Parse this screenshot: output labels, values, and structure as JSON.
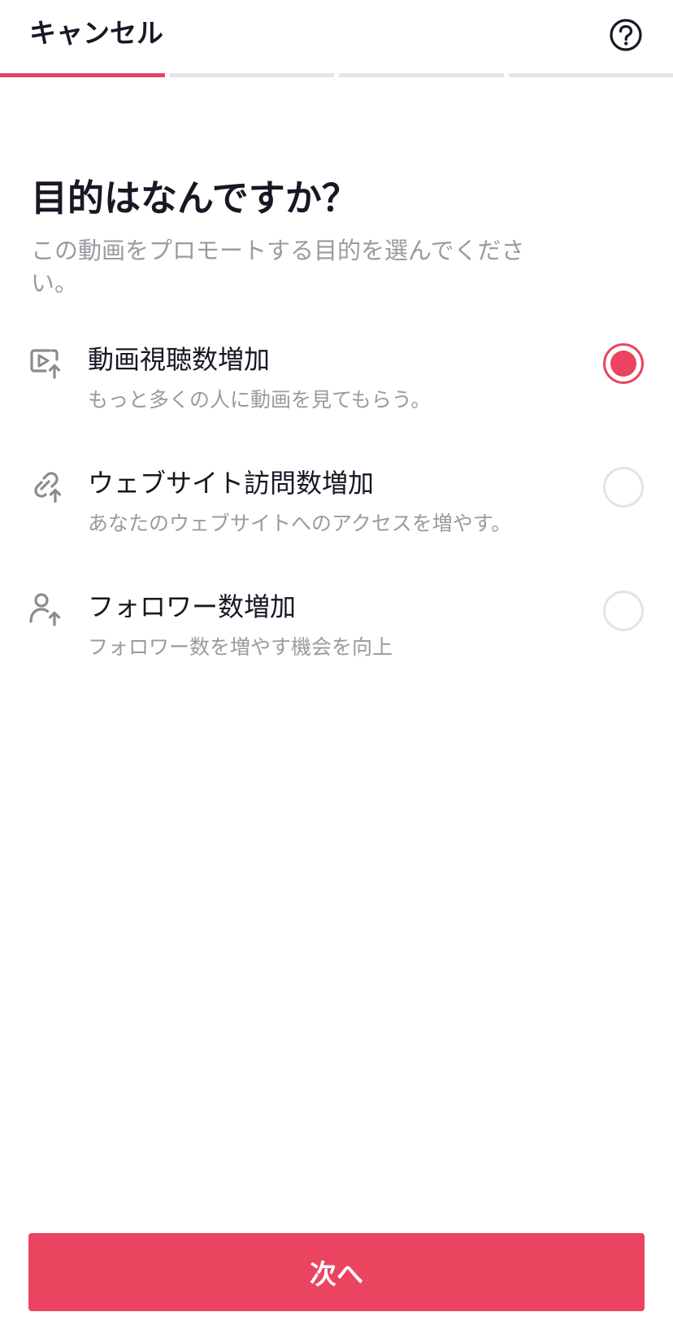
{
  "header": {
    "cancel_label": "キャンセル",
    "help_icon": "question-circle-icon"
  },
  "progress": {
    "total_steps": 4,
    "current_step": 1
  },
  "main": {
    "title": "目的はなんですか？",
    "subtitle": "この動画をプロモートする目的を選んでください。"
  },
  "options": [
    {
      "icon": "video-play-upload-icon",
      "title": "動画視聴数増加",
      "description": "もっと多くの人に動画を見てもらう。",
      "selected": true
    },
    {
      "icon": "link-upload-icon",
      "title": "ウェブサイト訪問数増加",
      "description": "あなたのウェブサイトへのアクセスを増やす。",
      "selected": false
    },
    {
      "icon": "user-upload-icon",
      "title": "フォロワー数増加",
      "description": "フォロワー数を増やす機会を向上",
      "selected": false
    }
  ],
  "footer": {
    "next_label": "次へ"
  },
  "colors": {
    "accent": "#ea4460",
    "text_primary": "#161823",
    "text_secondary": "#9a9ba0",
    "step_inactive": "#e6e6e8"
  }
}
